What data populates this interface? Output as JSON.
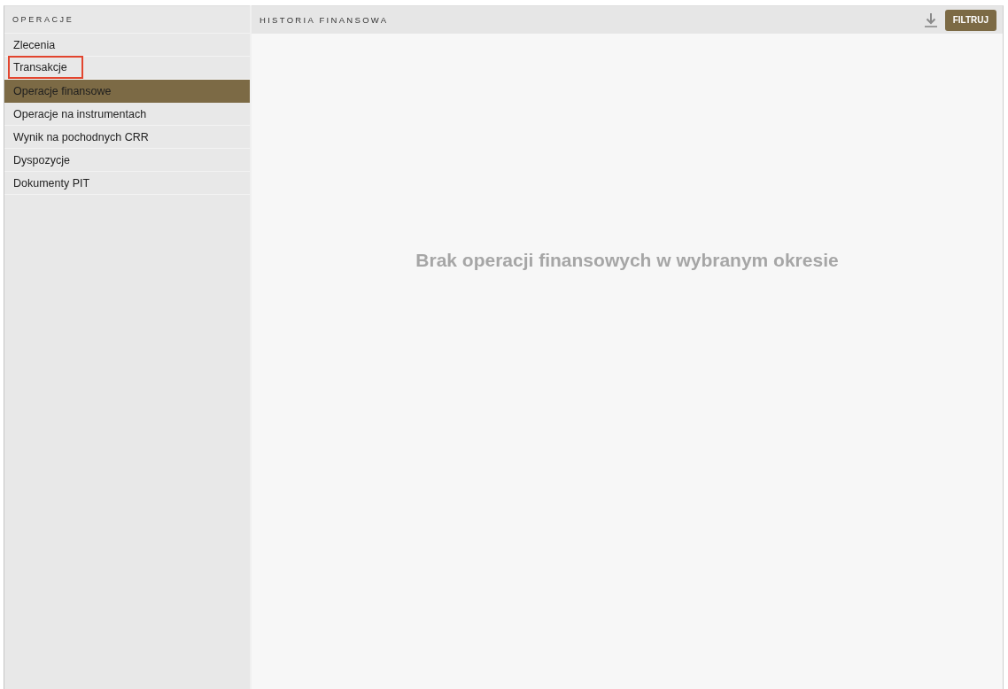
{
  "sidebar": {
    "title": "OPERACJE",
    "items": [
      {
        "label": "Zlecenia",
        "selected": false,
        "highlighted": false
      },
      {
        "label": "Transakcje",
        "selected": false,
        "highlighted": true
      },
      {
        "label": "Operacje finansowe",
        "selected": true,
        "highlighted": false
      },
      {
        "label": "Operacje na instrumentach",
        "selected": false,
        "highlighted": false
      },
      {
        "label": "Wynik na pochodnych CRR",
        "selected": false,
        "highlighted": false
      },
      {
        "label": "Dyspozycje",
        "selected": false,
        "highlighted": false
      },
      {
        "label": "Dokumenty PIT",
        "selected": false,
        "highlighted": false
      }
    ]
  },
  "main": {
    "title": "HISTORIA FINANSOWA",
    "filter_button": "FILTRUJ",
    "empty_message": "Brak operacji finansowych w wybranym okresie"
  }
}
